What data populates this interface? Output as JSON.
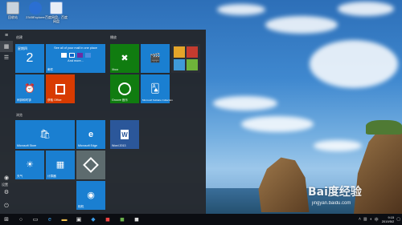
{
  "desktop": {
    "icons": [
      {
        "label": "回收站",
        "color": "#b9c4cf"
      },
      {
        "label": "2345Explorer",
        "color": "#2b6fd2"
      },
      {
        "label": "百度网盘，百度网盘",
        "color": "#e8eef7"
      }
    ]
  },
  "start_menu": {
    "rail": {
      "settings_label": "设置"
    },
    "groups": {
      "first": "创建",
      "second": "浏览",
      "play": "播放"
    },
    "tiles": {
      "calendar": {
        "day": "星期四",
        "date": "2"
      },
      "mail": {
        "headline": "See all of your mail in one place",
        "sub": "And more...",
        "label": "邮件"
      },
      "alarm": {
        "label": "闹钟和时钟"
      },
      "office": {
        "label": "获取 Office"
      },
      "xbox": {
        "label": "Xbox"
      },
      "movies": {
        "label": ""
      },
      "store_games": {
        "label": ""
      },
      "groove": {
        "label": "Groove 音乐"
      },
      "solitaire": {
        "label": "Microsoft Solitaire Collection"
      },
      "store": {
        "label": "Microsoft Store"
      },
      "edge": {
        "label": "Microsoft Edge"
      },
      "word": {
        "label": "Word 2013"
      },
      "weather": {
        "label": "天气"
      },
      "calculator": {
        "label": "计算器"
      },
      "settings_tile": {
        "label": ""
      },
      "camera": {
        "label": "相机"
      }
    }
  },
  "taskbar": {
    "tray_text": "中",
    "time": "9:15",
    "date": "2019/5/2"
  },
  "watermark": {
    "brand": "Bai度经验",
    "url": "jingyan.baidu.com"
  }
}
